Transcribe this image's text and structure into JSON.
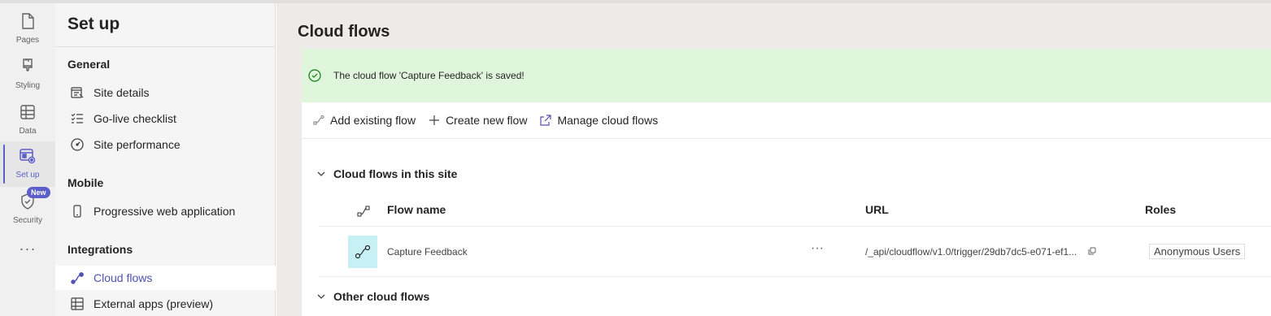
{
  "rail": {
    "items": [
      {
        "label": "Pages",
        "icon": "page-icon"
      },
      {
        "label": "Styling",
        "icon": "paintbrush-icon"
      },
      {
        "label": "Data",
        "icon": "table-icon"
      },
      {
        "label": "Set up",
        "icon": "setup-icon",
        "active": true
      },
      {
        "label": "Security",
        "icon": "shield-icon",
        "badge": "New"
      }
    ],
    "more": "···"
  },
  "panel": {
    "title": "Set up",
    "sections": [
      {
        "heading": "General",
        "items": [
          "Site details",
          "Go-live checklist",
          "Site performance"
        ]
      },
      {
        "heading": "Mobile",
        "items": [
          "Progressive web application"
        ]
      },
      {
        "heading": "Integrations",
        "items": [
          "Cloud flows",
          "External apps (preview)"
        ]
      }
    ],
    "active_item": "Cloud flows"
  },
  "main": {
    "title": "Cloud flows",
    "banner": "The cloud flow 'Capture Feedback' is saved!",
    "toolbar": {
      "add_existing": "Add existing flow",
      "create_new": "Create new flow",
      "manage": "Manage cloud flows"
    },
    "group_site": "Cloud flows in this site",
    "group_other": "Other cloud flows",
    "columns": {
      "name": "Flow name",
      "url": "URL",
      "roles": "Roles"
    },
    "rows": [
      {
        "name": "Capture Feedback",
        "url": "/_api/cloudflow/v1.0/trigger/29db7dc5-e071-ef1...",
        "role": "Anonymous Users",
        "more": "···"
      }
    ]
  },
  "colors": {
    "accent": "#5b5fc7",
    "success_bg": "#dff6dd",
    "success_icon": "#107c10",
    "flow_tile": "#c7f0f5"
  }
}
